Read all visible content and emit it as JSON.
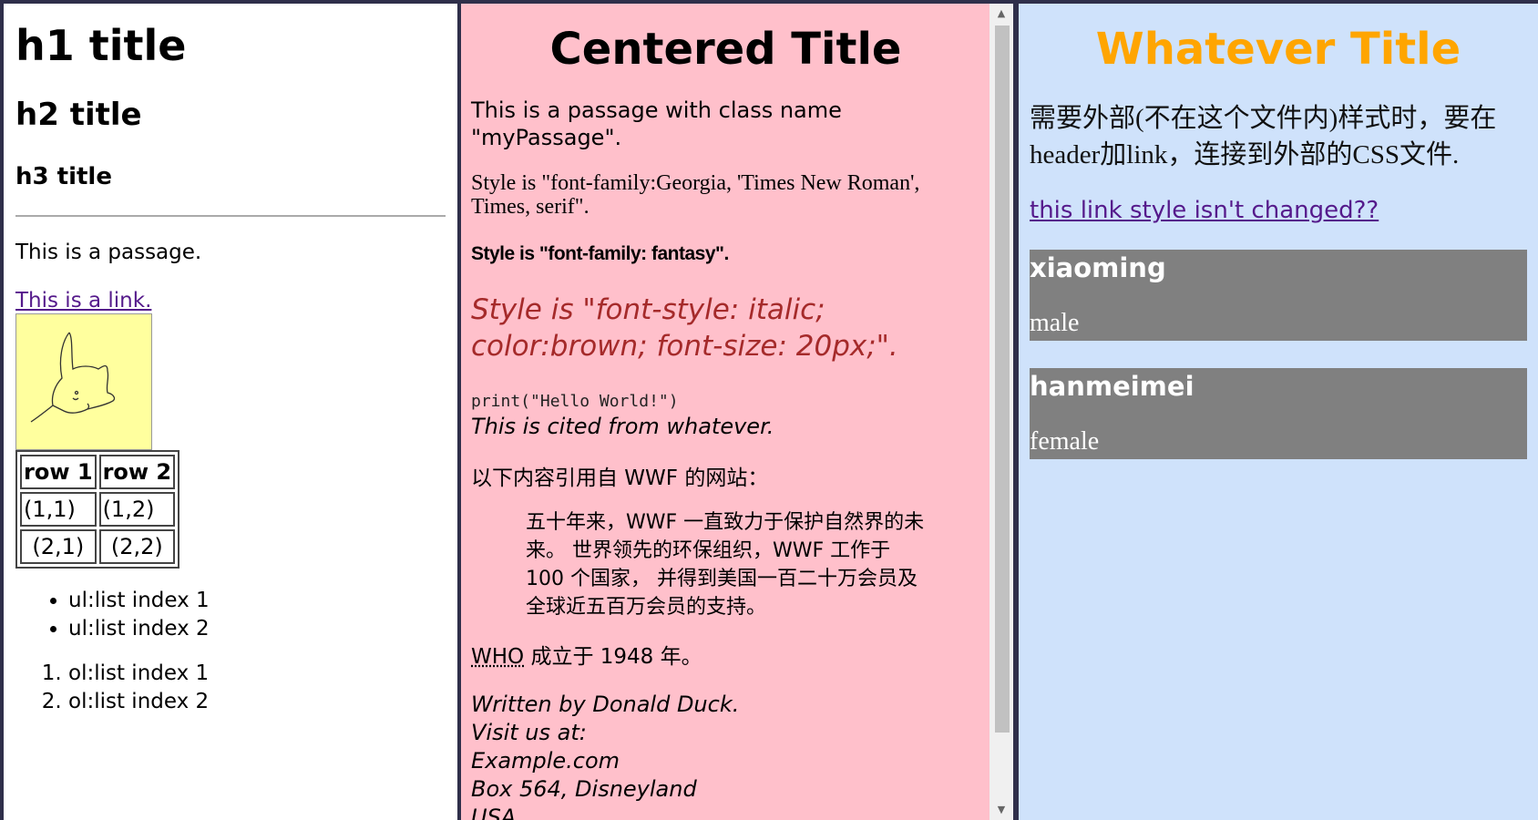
{
  "left": {
    "h1": "h1 title",
    "h2": "h2 title",
    "h3": "h3 title",
    "passage": "This is a passage.",
    "link": "This is a link.",
    "image": "kitten-sketch",
    "table": {
      "headers": [
        "row 1",
        "row 2"
      ],
      "rows": [
        [
          "(1,1)",
          "(1,2)"
        ],
        [
          "(2,1)",
          "(2,2)"
        ]
      ]
    },
    "ul": [
      "ul:list index 1",
      "ul:list index 2"
    ],
    "ol": [
      "ol:list index 1",
      "ol:list index 2"
    ]
  },
  "middle": {
    "title": "Centered Title",
    "p1": "This is a passage with class name \"myPassage\".",
    "p2": "Style is \"font-family:Georgia, 'Times New Roman', Times, serif\".",
    "p3": "Style is \"font-family: fantasy\".",
    "p4": "Style is \"font-style: italic; color:brown; font-size: 20px;\".",
    "code": "print(\"Hello World!\")",
    "cite": "This is cited from whatever.",
    "quote_intro": "以下内容引用自 WWF 的网站：",
    "blockquote": "五十年来，WWF 一直致力于保护自然界的未来。 世界领先的环保组织，WWF 工作于 100 个国家， 并得到美国一百二十万会员及全球近五百万会员的支持。",
    "who_abbr": "WHO",
    "who_rest": " 成立于 1948 年。",
    "address": [
      "Written by Donald Duck.",
      "Visit us at:",
      "Example.com",
      "Box 564, Disneyland",
      "USA"
    ]
  },
  "right": {
    "title": "Whatever Title",
    "title_color": "#ffa500",
    "paragraph": "需要外部(不在这个文件内)样式时，要在header加link，连接到外部的CSS文件.",
    "link": "this link style isn't changed??",
    "people": [
      {
        "name": "xiaoming",
        "gender": "male"
      },
      {
        "name": "hanmeimei",
        "gender": "female"
      }
    ]
  },
  "colors": {
    "left_bg": "#ffffff",
    "middle_bg": "#ffc0cb",
    "right_bg": "#cfe2fb",
    "card_bg": "#808080",
    "brown": "#a52a2a",
    "visited_link": "#551a8b"
  }
}
